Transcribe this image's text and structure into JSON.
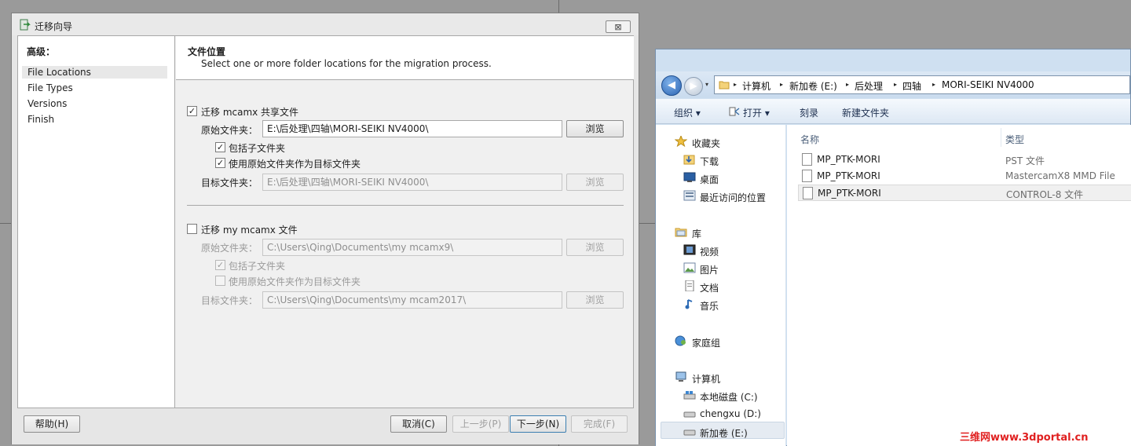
{
  "wizard": {
    "title": "迁移向导",
    "close_glyph": "⊠",
    "nav": {
      "heading": "高级：",
      "items": [
        {
          "label": "File Locations"
        },
        {
          "label": "File Types"
        },
        {
          "label": "Versions"
        },
        {
          "label": "Finish"
        }
      ]
    },
    "header": {
      "title": "文件位置",
      "subtitle": "Select one or more folder locations for the migration process."
    },
    "shared": {
      "checkbox_label": "迁移 mcamx 共享文件",
      "checked": true,
      "source_label": "原始文件夹：",
      "source_value": "E:\\后处理\\四轴\\MORI-SEIKI NV4000\\",
      "browse": "浏览",
      "include_sub": "包括子文件夹",
      "use_source": "使用原始文件夹作为目标文件夹",
      "target_label": "目标文件夹：",
      "target_value": "E:\\后处理\\四轴\\MORI-SEIKI NV4000\\",
      "browse2": "浏览"
    },
    "my": {
      "checkbox_label": "迁移 my mcamx 文件",
      "checked": false,
      "source_label": "原始文件夹：",
      "source_value": "C:\\Users\\Qing\\Documents\\my mcamx9\\",
      "browse": "浏览",
      "include_sub": "包括子文件夹",
      "use_source": "使用原始文件夹作为目标文件夹",
      "target_label": "目标文件夹：",
      "target_value": "C:\\Users\\Qing\\Documents\\my mcam2017\\",
      "browse2": "浏览"
    },
    "buttons": {
      "help": "帮助(H)",
      "cancel": "取消(C)",
      "prev": "上一步(P)",
      "next": "下一步(N)",
      "finish": "完成(F)"
    },
    "check_glyph": "✓"
  },
  "explorer": {
    "back_glyph": "◀",
    "fwd_glyph": "▶",
    "drop_glyph": "▾",
    "arrow_glyph": "▸",
    "breadcrumb": [
      "计算机",
      "新加卷 (E:)",
      "后处理",
      "四轴",
      "MORI-SEIKI NV4000"
    ],
    "toolbar": {
      "organize": "组织 ▾",
      "open": "打开 ▾",
      "burn": "刻录",
      "new_folder": "新建文件夹"
    },
    "tree": {
      "favorites": "收藏夹",
      "downloads": "下载",
      "desktop": "桌面",
      "recent": "最近访问的位置",
      "libraries": "库",
      "videos": "视频",
      "pictures": "图片",
      "documents": "文档",
      "music": "音乐",
      "homegroup": "家庭组",
      "computer": "计算机",
      "local_c": "本地磁盘 (C:)",
      "chengxu_d": "chengxu (D:)",
      "newvol_e": "新加卷 (E:)"
    },
    "columns": {
      "name": "名称",
      "type": "类型"
    },
    "files": [
      {
        "name": "MP_PTK-MORI",
        "type": "PST 文件"
      },
      {
        "name": "MP_PTK-MORI",
        "type": "MastercamX8 MMD File"
      },
      {
        "name": "MP_PTK-MORI",
        "type": "CONTROL-8 文件"
      }
    ]
  },
  "watermark": "三维网www.3dportal.cn"
}
